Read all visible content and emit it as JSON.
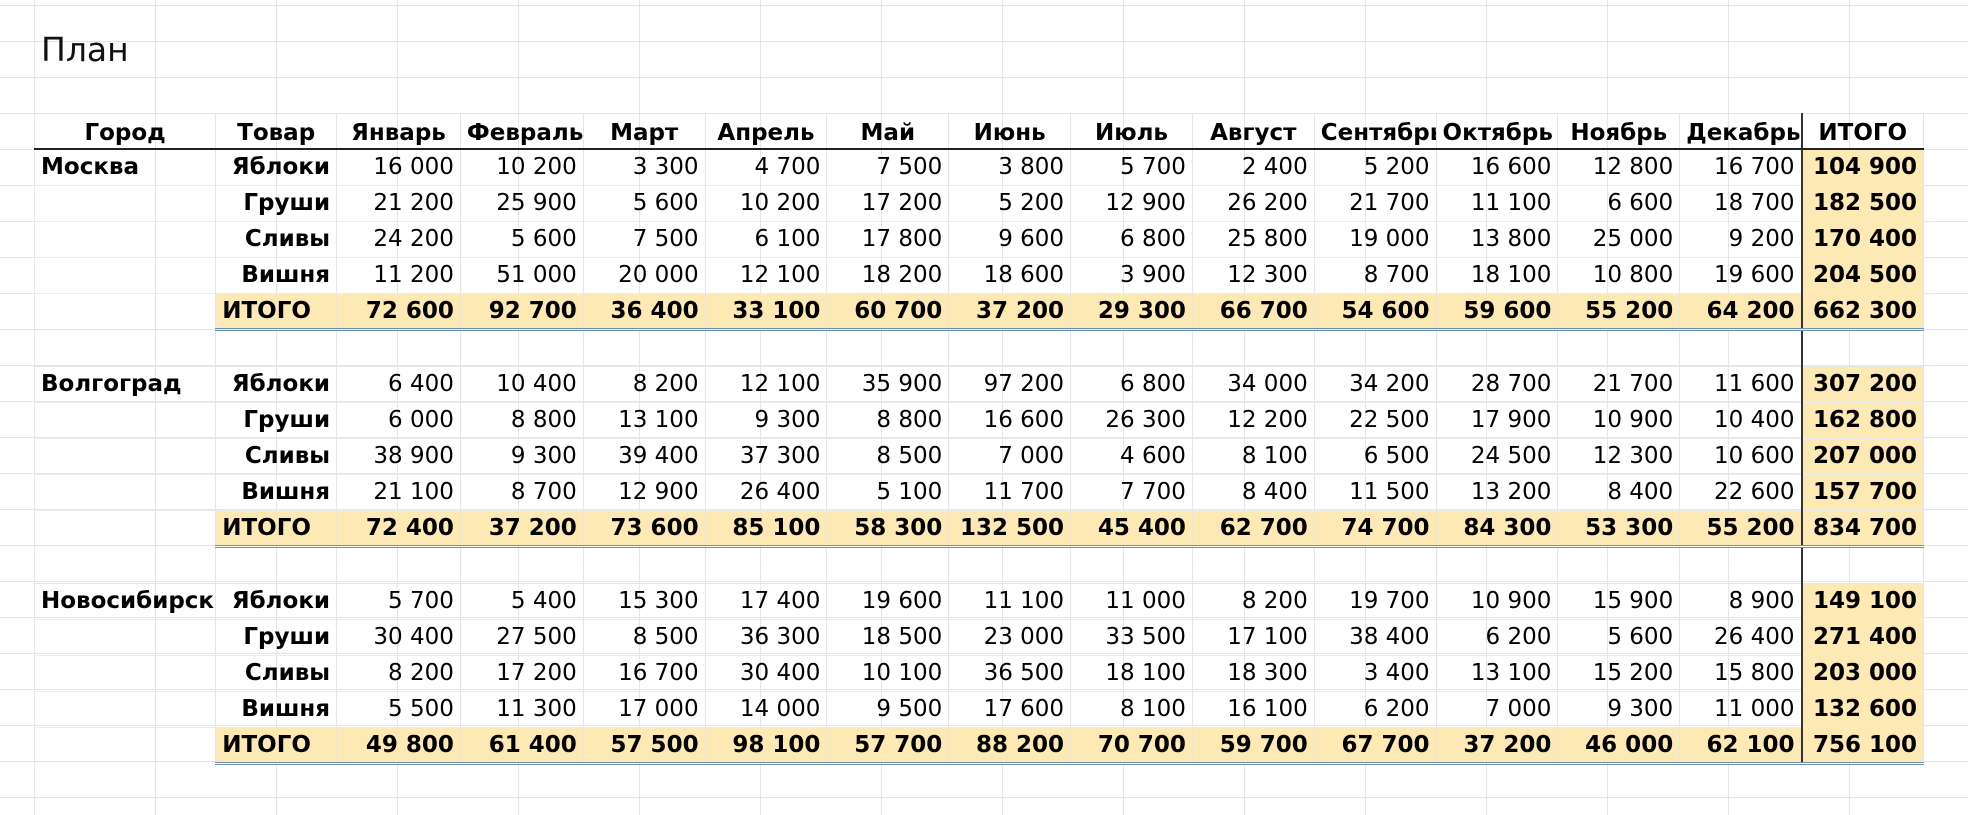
{
  "title": "План",
  "header": {
    "city": "Город",
    "product": "Товар",
    "months": [
      "Январь",
      "Февраль",
      "Март",
      "Апрель",
      "Май",
      "Июнь",
      "Июль",
      "Август",
      "Сентябрь",
      "Октябрь",
      "Ноябрь",
      "Декабрь"
    ],
    "total": "ИТОГО"
  },
  "colors": {
    "total_fill": "#fde9b4",
    "grid_line": "#e6e6e6",
    "double_rule": "#6f8fb0"
  },
  "blocks": [
    {
      "city": "Москва",
      "rows": [
        {
          "product": "Яблоки",
          "values": [
            "16 000",
            "10 200",
            "3 300",
            "4 700",
            "7 500",
            "3 800",
            "5 700",
            "2 400",
            "5 200",
            "16 600",
            "12 800",
            "16 700"
          ],
          "total": "104 900"
        },
        {
          "product": "Груши",
          "values": [
            "21 200",
            "25 900",
            "5 600",
            "10 200",
            "17 200",
            "5 200",
            "12 900",
            "26 200",
            "21 700",
            "11 100",
            "6 600",
            "18 700"
          ],
          "total": "182 500"
        },
        {
          "product": "Сливы",
          "values": [
            "24 200",
            "5 600",
            "7 500",
            "6 100",
            "17 800",
            "9 600",
            "6 800",
            "25 800",
            "19 000",
            "13 800",
            "25 000",
            "9 200"
          ],
          "total": "170 400"
        },
        {
          "product": "Вишня",
          "values": [
            "11 200",
            "51 000",
            "20 000",
            "12 100",
            "18 200",
            "18 600",
            "3 900",
            "12 300",
            "8 700",
            "18 100",
            "10 800",
            "19 600"
          ],
          "total": "204 500"
        }
      ],
      "totals": {
        "label": "ИТОГО",
        "values": [
          "72 600",
          "92 700",
          "36 400",
          "33 100",
          "60 700",
          "37 200",
          "29 300",
          "66 700",
          "54 600",
          "59 600",
          "55 200",
          "64 200"
        ],
        "total": "662 300"
      }
    },
    {
      "city": "Волгоград",
      "rows": [
        {
          "product": "Яблоки",
          "values": [
            "6 400",
            "10 400",
            "8 200",
            "12 100",
            "35 900",
            "97 200",
            "6 800",
            "34 000",
            "34 200",
            "28 700",
            "21 700",
            "11 600"
          ],
          "total": "307 200"
        },
        {
          "product": "Груши",
          "values": [
            "6 000",
            "8 800",
            "13 100",
            "9 300",
            "8 800",
            "16 600",
            "26 300",
            "12 200",
            "22 500",
            "17 900",
            "10 900",
            "10 400"
          ],
          "total": "162 800"
        },
        {
          "product": "Сливы",
          "values": [
            "38 900",
            "9 300",
            "39 400",
            "37 300",
            "8 500",
            "7 000",
            "4 600",
            "8 100",
            "6 500",
            "24 500",
            "12 300",
            "10 600"
          ],
          "total": "207 000"
        },
        {
          "product": "Вишня",
          "values": [
            "21 100",
            "8 700",
            "12 900",
            "26 400",
            "5 100",
            "11 700",
            "7 700",
            "8 400",
            "11 500",
            "13 200",
            "8 400",
            "22 600"
          ],
          "total": "157 700"
        }
      ],
      "totals": {
        "label": "ИТОГО",
        "values": [
          "72 400",
          "37 200",
          "73 600",
          "85 100",
          "58 300",
          "132 500",
          "45 400",
          "62 700",
          "74 700",
          "84 300",
          "53 300",
          "55 200"
        ],
        "total": "834 700"
      }
    },
    {
      "city": "Новосибирск",
      "rows": [
        {
          "product": "Яблоки",
          "values": [
            "5 700",
            "5 400",
            "15 300",
            "17 400",
            "19 600",
            "11 100",
            "11 000",
            "8 200",
            "19 700",
            "10 900",
            "15 900",
            "8 900"
          ],
          "total": "149 100"
        },
        {
          "product": "Груши",
          "values": [
            "30 400",
            "27 500",
            "8 500",
            "36 300",
            "18 500",
            "23 000",
            "33 500",
            "17 100",
            "38 400",
            "6 200",
            "5 600",
            "26 400"
          ],
          "total": "271 400"
        },
        {
          "product": "Сливы",
          "values": [
            "8 200",
            "17 200",
            "16 700",
            "30 400",
            "10 100",
            "36 500",
            "18 100",
            "18 300",
            "3 400",
            "13 100",
            "15 200",
            "15 800"
          ],
          "total": "203 000"
        },
        {
          "product": "Вишня",
          "values": [
            "5 500",
            "11 300",
            "17 000",
            "14 000",
            "9 500",
            "17 600",
            "8 100",
            "16 100",
            "6 200",
            "7 000",
            "9 300",
            "11 000"
          ],
          "total": "132 600"
        }
      ],
      "totals": {
        "label": "ИТОГО",
        "values": [
          "49 800",
          "61 400",
          "57 500",
          "98 100",
          "57 700",
          "88 200",
          "70 700",
          "59 700",
          "67 700",
          "37 200",
          "46 000",
          "62 100"
        ],
        "total": "756 100"
      }
    }
  ]
}
